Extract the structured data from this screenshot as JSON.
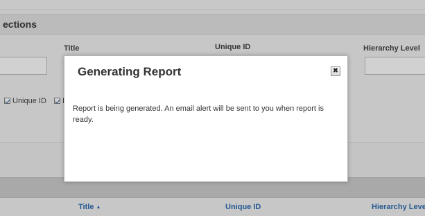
{
  "background": {
    "section_title": "ections",
    "fields": {
      "title_label": "Title",
      "unique_id_label": "Unique ID",
      "hierarchy_label": "Hierarchy Level"
    },
    "column_options": [
      {
        "label": "Unique ID",
        "checked": true
      },
      {
        "label": "I",
        "checked": true
      }
    ],
    "grid_columns": [
      {
        "label": "Title",
        "sort": "ascending",
        "sort_icon": "sort-asc-icon"
      },
      {
        "label": "Unique ID"
      },
      {
        "label": "Hierarchy Leve"
      }
    ]
  },
  "dialog": {
    "title": "Generating Report",
    "close_label": "✖",
    "close_icon": "close-icon",
    "message": "Report is being generated. An email alert will be sent to you when report is ready."
  },
  "colors": {
    "link": "#2e6db4",
    "overlay": "#c9c9c9",
    "dialog_bg": "#ffffff"
  }
}
